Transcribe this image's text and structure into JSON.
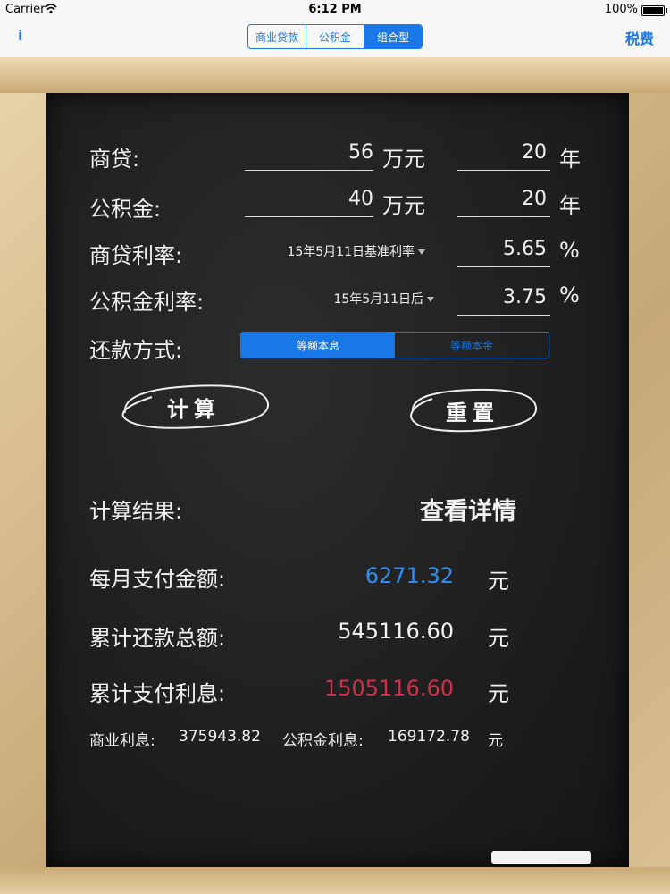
{
  "status_bar": {
    "carrier": "Carrier",
    "time": "6:12 PM",
    "battery": "100%"
  },
  "nav": {
    "info": "i",
    "tax": "税费",
    "segments": [
      {
        "label": "商业贷款",
        "active": false
      },
      {
        "label": "公积金",
        "active": false
      },
      {
        "label": "组合型",
        "active": true
      }
    ]
  },
  "form": {
    "commercial_loan": {
      "label": "商贷:",
      "amount": "56",
      "amount_unit": "万元",
      "years": "20",
      "years_unit": "年"
    },
    "provident_fund": {
      "label": "公积金:",
      "amount": "40",
      "amount_unit": "万元",
      "years": "20",
      "years_unit": "年"
    },
    "commercial_rate": {
      "label": "商贷利率:",
      "rate_type": "15年5月11日基准利率",
      "rate": "5.65",
      "unit": "%"
    },
    "provident_rate": {
      "label": "公积金利率:",
      "rate_type": "15年5月11日后",
      "rate": "3.75",
      "unit": "%"
    },
    "repayment": {
      "label": "还款方式:",
      "options": [
        "等额本息",
        "等额本金"
      ],
      "selected": "等额本息"
    }
  },
  "buttons": {
    "calculate": "计算",
    "reset": "重置"
  },
  "results": {
    "title": "计算结果:",
    "detail_link": "查看详情",
    "monthly_label": "每月支付金额:",
    "monthly_value": "6271.32",
    "monthly_unit": "元",
    "total_label": "累计还款总额:",
    "total_value": "545116.60",
    "total_unit": "元",
    "interest_label": "累计支付利息:",
    "interest_value": "1505116.60",
    "interest_unit": "元",
    "commercial_interest_label": "商业利息:",
    "commercial_interest_value": "375943.82",
    "provident_interest_label": "公积金利息:",
    "provident_interest_value": "169172.78",
    "breakdown_unit": "元"
  },
  "colors": {
    "accent": "#1a78e6",
    "monthly": "#2f8ff0",
    "interest": "#d0304a"
  }
}
